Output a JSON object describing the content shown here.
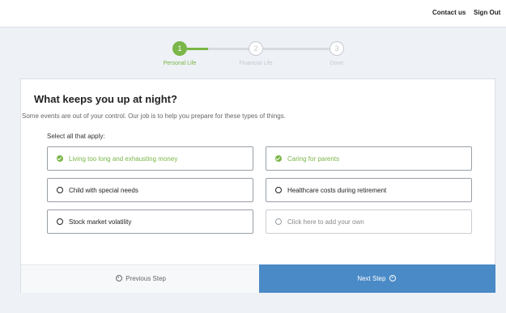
{
  "header": {
    "contact_label": "Contact us",
    "signout_label": "Sign Out"
  },
  "stepper": {
    "steps": [
      {
        "number": "1",
        "label": "Personal Life",
        "state": "active"
      },
      {
        "number": "2",
        "label": "Financial Life",
        "state": "inactive"
      },
      {
        "number": "3",
        "label": "Done",
        "state": "inactive"
      }
    ]
  },
  "question": {
    "title": "What keeps you up at night?",
    "subtitle": "Some events are out of your control. Our job is to help you prepare for these types of things.",
    "instruction": "Select all that apply:"
  },
  "options": [
    {
      "label": "Living too long and exhausting money",
      "selected": true
    },
    {
      "label": "Caring for parents",
      "selected": true
    },
    {
      "label": "Child with special needs",
      "selected": false
    },
    {
      "label": "Healthcare costs during retirement",
      "selected": false
    },
    {
      "label": "Stock market volatility",
      "selected": false
    },
    {
      "label": "Click here to add your own",
      "selected": false
    }
  ],
  "footer": {
    "prev_label": "Previous Step",
    "next_label": "Next Step"
  },
  "colors": {
    "accent_green": "#7ab648",
    "primary_blue": "#4a8ac6"
  },
  "icons": {
    "check": "check-circle-icon",
    "radio": "radio-circle-icon",
    "prev": "arrow-left-circle-icon",
    "next": "arrow-right-circle-icon"
  }
}
